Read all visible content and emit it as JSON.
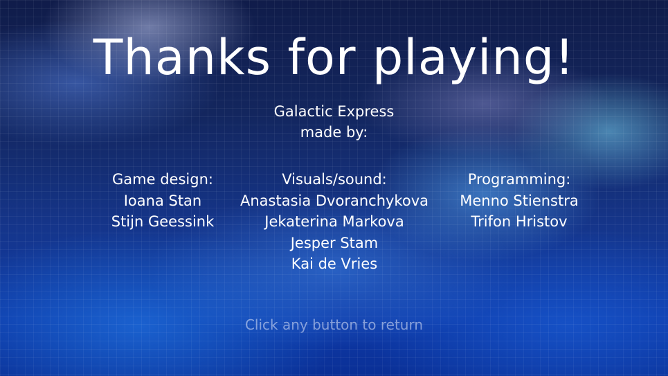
{
  "screen": {
    "title": "Thanks for playing!",
    "game_name": "Galactic Express",
    "made_by": "made by:",
    "footer_prompt": "Click any button to return"
  },
  "credits": {
    "game_design": {
      "heading": "Game design:",
      "names": [
        "Ioana Stan",
        "Stijn Geessink"
      ]
    },
    "visuals_sound": {
      "heading": "Visuals/sound:",
      "names": [
        "Anastasia Dvoranchykova",
        "Jekaterina Markova",
        "Jesper Stam",
        "Kai de Vries"
      ]
    },
    "programming": {
      "heading": "Programming:",
      "names": [
        "Menno Stienstra",
        "Trifon Hristov"
      ]
    }
  },
  "colors": {
    "text": "#ffffff",
    "footer_text": "#c8d2f0",
    "background_top": "#101c4a",
    "background_bottom": "#0a2f95"
  }
}
